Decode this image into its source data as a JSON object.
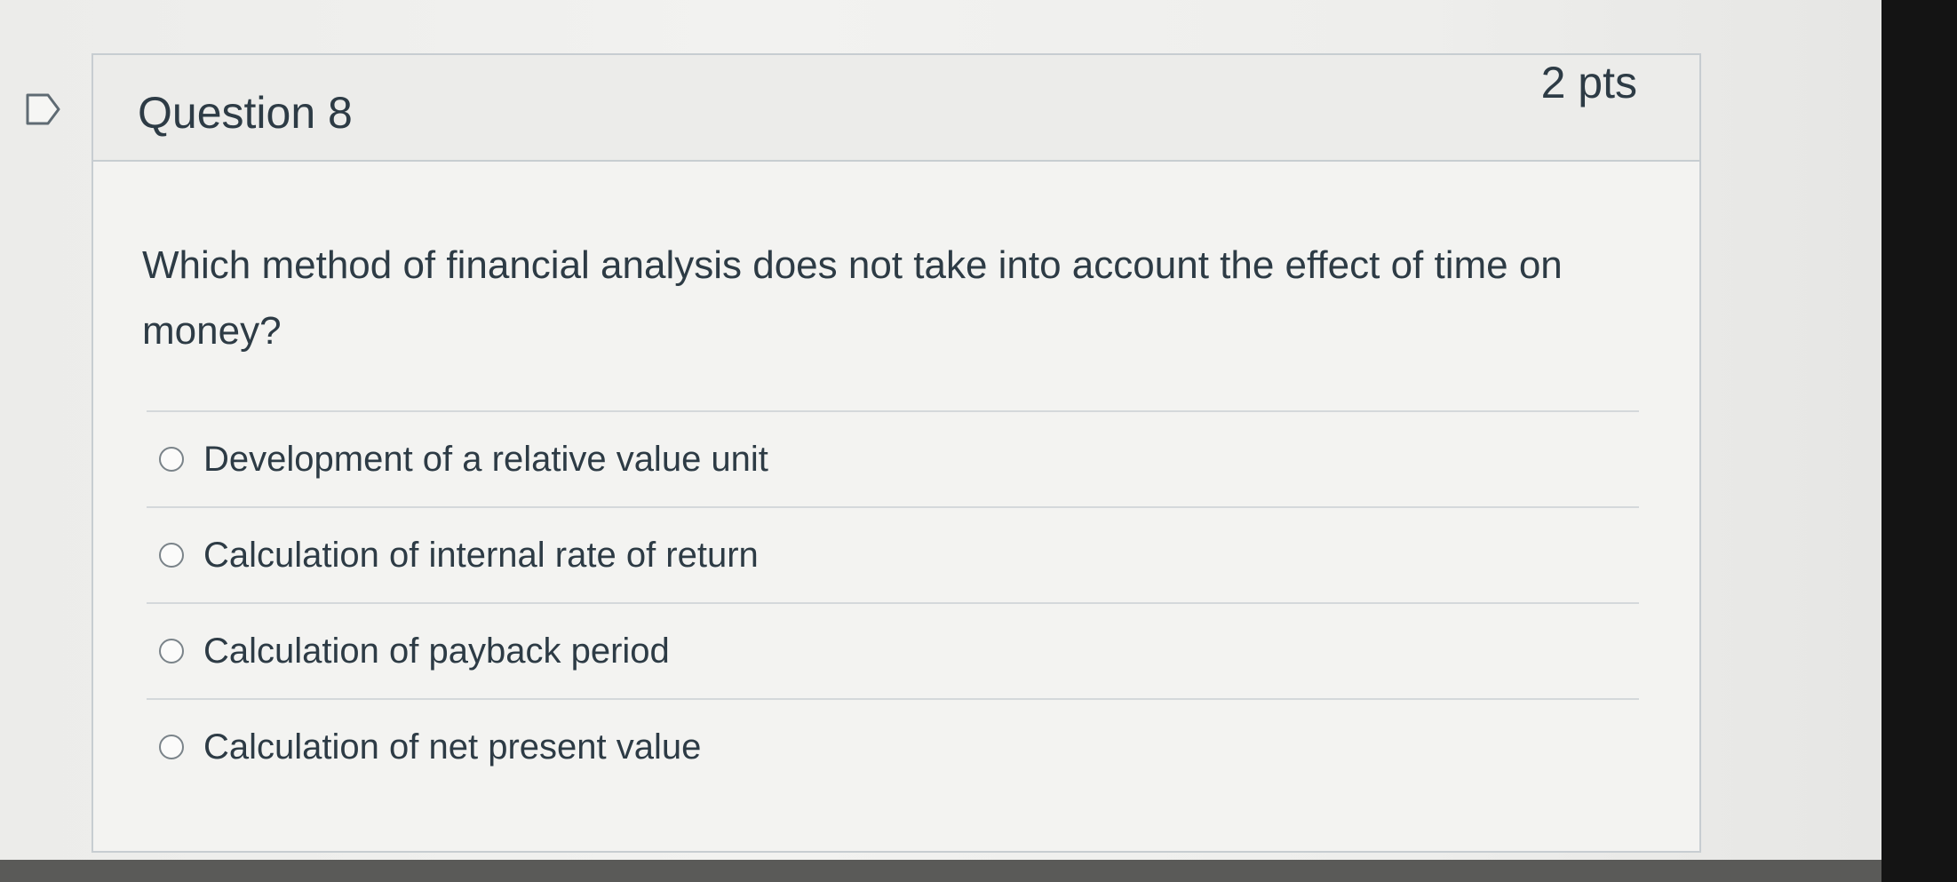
{
  "question": {
    "title": "Question 8",
    "points": "2 pts",
    "text": "Which method of financial analysis does not take into account the effect of time on money?",
    "answers": [
      {
        "label": "Development of a relative value unit"
      },
      {
        "label": "Calculation of internal rate of return"
      },
      {
        "label": "Calculation of payback period"
      },
      {
        "label": "Calculation of net present value"
      }
    ]
  },
  "icons": {
    "flag": "flag-question-icon",
    "radio": "radio-unselected-icon"
  },
  "colors": {
    "text": "#2d3b45",
    "border": "#c7cdd1",
    "header_bg": "#ececea"
  }
}
